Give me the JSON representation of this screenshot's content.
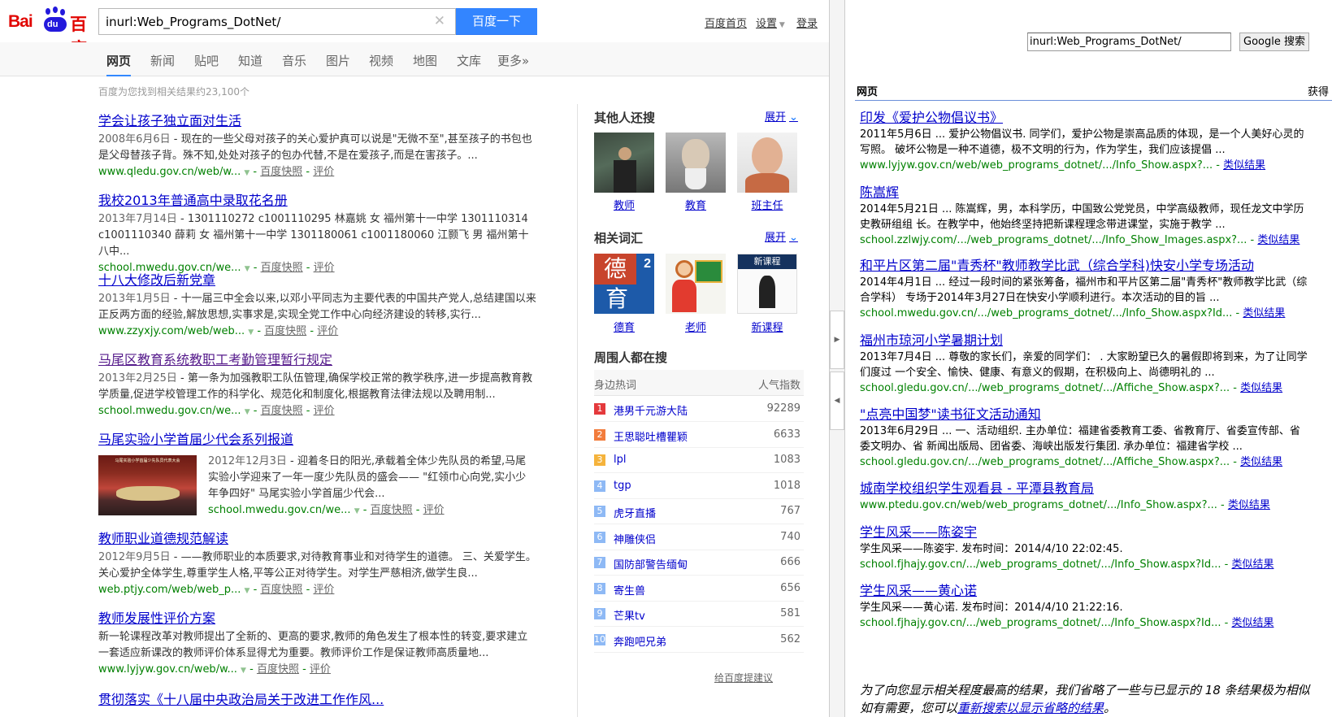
{
  "baidu": {
    "logo_latin": "Bai",
    "logo_du": "du",
    "logo_cn": "百度",
    "query": "inurl:Web_Programs_DotNet/",
    "search_button": "百度一下",
    "top_links": [
      "百度首页",
      "设置",
      "登录"
    ],
    "tabs": [
      "网页",
      "新闻",
      "贴吧",
      "知道",
      "音乐",
      "图片",
      "视频",
      "地图",
      "文库",
      "更多»"
    ],
    "result_count": "百度为您找到相关结果约23,100个",
    "results": [
      {
        "title": "学会让孩子独立面对生活",
        "date": "2008年6月6日",
        "abstract": " - 现在的一些父母对孩子的关心爱护真可以说是\"无微不至\",甚至孩子的书包也是父母替孩子背。殊不知,处处对孩子的包办代替,不是在爱孩子,而是在害孩子。...",
        "url": "www.qledu.gov.cn/web/w...",
        "visited": false
      },
      {
        "title": "我校2013年普通高中录取花名册",
        "date": "2013年7月14日",
        "abstract": " - 1301110272 c1001110295 林嘉姚 女 福州第十一中学 1301110314 c1001110340 薛莉 女 福州第十一中学 1301180061 c1001180060 江颢飞 男 福州第十八中...",
        "url": "school.mwedu.gov.cn/we...",
        "visited": false
      },
      {
        "title": "十八大修改后新党章",
        "date": "2013年1月5日",
        "abstract": " - 十一届三中全会以来,以邓小平同志为主要代表的中国共产党人,总结建国以来正反两方面的经验,解放思想,实事求是,实现全党工作中心向经济建设的转移,实行...",
        "url": "www.zzyxjy.com/web/web...",
        "visited": false
      },
      {
        "title": "马尾区教育系统教职工考勤管理暂行规定",
        "date": "2013年2月25日",
        "abstract": " - 第一条为加强教职工队伍管理,确保学校正常的教学秩序,进一步提高教育教学质量,促进学校管理工作的科学化、规范化和制度化,根据教育法律法规以及聘用制...",
        "url": "school.mwedu.gov.cn/we...",
        "visited": true
      },
      {
        "title": "马尾实验小学首届少代会系列报道",
        "date": "2012年12月3日",
        "abstract": " - 迎着冬日的阳光,承载着全体少先队员的希望,马尾实验小学迎来了一年一度少先队员的盛会—— \"红领巾心向党,实小少年争四好\" 马尾实验小学首届少代会...",
        "url": "school.mwedu.gov.cn/we...",
        "visited": false
      },
      {
        "title": "教师职业道德规范解读",
        "date": "2012年9月5日",
        "abstract": " - ——教师职业的本质要求,对待教育事业和对待学生的道德。 三、关爱学生。关心爱护全体学生,尊重学生人格,平等公正对待学生。对学生严慈相济,做学生良...",
        "url": "web.ptjy.com/web/web_p...",
        "visited": false
      },
      {
        "title": "教师发展性评价方案",
        "date": "",
        "abstract": "新一轮课程改革对教师提出了全新的、更高的要求,教师的角色发生了根本性的转变,要求建立一套适应新课改的教师评价体系显得尤为重要。教师评价工作是保证教师高质量地...",
        "url": "www.lyjyw.gov.cn/web/w...",
        "visited": false
      },
      {
        "title": "贯彻落实《十八届中央政治局关于改进工作作风...",
        "date": "",
        "abstract": "",
        "url": "",
        "visited": false
      }
    ],
    "kuaizhao": "百度快照",
    "pingjia": "评价",
    "side": {
      "others_title": "其他人还搜",
      "expand": "展开",
      "others": [
        "教师",
        "教育",
        "班主任"
      ],
      "related_title": "相关词汇",
      "related": [
        "德育",
        "老师",
        "新课程"
      ],
      "hot_title": "周围人都在搜",
      "hot_col1": "身边热词",
      "hot_col2": "人气指数",
      "hot": [
        {
          "rank": "1",
          "word": "港男千元游大陆",
          "score": "92289",
          "color": "#e4393c"
        },
        {
          "rank": "2",
          "word": "王思聪吐槽瞿颖",
          "score": "6633",
          "color": "#f27c3c"
        },
        {
          "rank": "3",
          "word": "lpl",
          "score": "1083",
          "color": "#f5b33c"
        },
        {
          "rank": "4",
          "word": "tgp",
          "score": "1018",
          "color": "#8eb9f5"
        },
        {
          "rank": "5",
          "word": "虎牙直播",
          "score": "767",
          "color": "#8eb9f5"
        },
        {
          "rank": "6",
          "word": "神雕侠侣",
          "score": "740",
          "color": "#8eb9f5"
        },
        {
          "rank": "7",
          "word": "国防部警告缅甸",
          "score": "666",
          "color": "#8eb9f5"
        },
        {
          "rank": "8",
          "word": "寄生兽",
          "score": "656",
          "color": "#8eb9f5"
        },
        {
          "rank": "9",
          "word": "芒果tv",
          "score": "581",
          "color": "#8eb9f5"
        },
        {
          "rank": "10",
          "word": "奔跑吧兄弟",
          "score": "562",
          "color": "#8eb9f5"
        }
      ],
      "feedback": "给百度提建议"
    },
    "thumb_caption": "马尾实验小学首届少先队员代表大会"
  },
  "google": {
    "query": "inurl:Web_Programs_DotNet/",
    "button": "Google 搜索",
    "bar_left": "网页",
    "bar_right": "获得",
    "results": [
      {
        "title": "印发《爱护公物倡议书》",
        "abstract": "2011年5月6日 ... 爱护公物倡议书. 同学们，爱护公物是崇高品质的体现，是一个人美好心灵的\n写照。 破坏公物是一种不道德，极不文明的行为，作为学生，我们应该提倡 ...",
        "url": "www.lyjyw.gov.cn/web/web_programs_dotnet/.../Info_Show.aspx?... - "
      },
      {
        "title": "陈嵩辉",
        "abstract": "2014年5月21日 ... 陈嵩辉，男，本科学历，中国致公党党员，中学高级教师，现任龙文中学历\n史教研组组 长。在教学中，他始终坚持把新课程理念带进课堂，实施于教学 ...",
        "url": "school.zzlwjy.com/.../web_programs_dotnet/.../Info_Show_Images.aspx?... - "
      },
      {
        "title": "和平片区第二届\"青秀杯\"教师教学比武（综合学科)快安小学专场活动",
        "abstract": "2014年4月1日 ... 经过一段时间的紧张筹备，福州市和平片区第二届\"青秀杯\"教师教学比武（综\n合学科） 专场于2014年3月27日在快安小学顺利进行。本次活动的目的旨 ...",
        "url": "school.mwedu.gov.cn/.../web_programs_dotnet/.../Info_Show.aspx?Id... - "
      },
      {
        "title": "福州市琼河小学暑期计划",
        "abstract": "2013年7月4日 ... 尊敬的家长们，亲爱的同学们： . 大家盼望已久的暑假即将到来，为了让同学\n们度过 一个安全、愉快、健康、有意义的假期，在积极向上、尚德明礼的 ...",
        "url": "school.gledu.gov.cn/.../web_programs_dotnet/.../Affiche_Show.aspx?... - "
      },
      {
        "title": "\"点亮中国梦\"读书征文活动通知",
        "abstract": "2013年6月29日 ... 一、活动组织. 主办单位：福建省委教育工委、省教育厅、省委宣传部、省\n委文明办、省 新闻出版局、团省委、海峡出版发行集团. 承办单位：福建省学校 ...",
        "url": "school.gledu.gov.cn/.../web_programs_dotnet/.../Affiche_Show.aspx?... - "
      },
      {
        "title": "城南学校组织学生观看县 - 平潭县教育局",
        "abstract": "",
        "url": "www.ptedu.gov.cn/web/web_programs_dotnet/.../Info_Show.aspx?... - "
      },
      {
        "title": "学生风采——陈姿宇",
        "abstract": "学生风采——陈姿宇. 发布时间：2014/4/10 22:02:45.",
        "url": "school.fjhajy.gov.cn/.../web_programs_dotnet/.../Info_Show.aspx?Id... - "
      },
      {
        "title": "学生风采——黄心诺",
        "abstract": "学生风采——黄心诺. 发布时间：2014/4/10 21:22:16.",
        "url": "school.fjhajy.gov.cn/.../web_programs_dotnet/.../Info_Show.aspx?Id... - "
      }
    ],
    "similar": "类似结果",
    "note_1": "为了向您显示相关程度最高的结果，我们省略了一些与已显示的 18 条结果极为相似",
    "note_2": "如有需要，您可以",
    "note_link": "重新搜索以显示省略的结果",
    "note_3": "。"
  }
}
